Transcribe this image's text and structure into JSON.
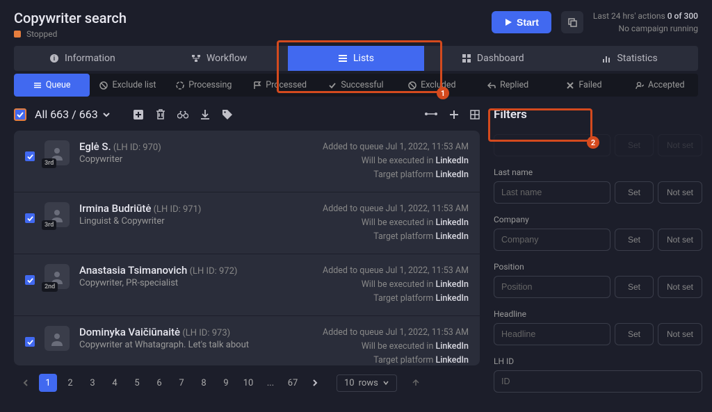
{
  "header": {
    "title": "Copywriter search",
    "status": "Stopped",
    "start_label": "Start",
    "stats_line1_prefix": "Last 24 hrs' actions ",
    "stats_line1_value": "0 of 300",
    "stats_line2": "No campaign running"
  },
  "main_tabs": {
    "information": "Information",
    "workflow": "Workflow",
    "lists": "Lists",
    "dashboard": "Dashboard",
    "statistics": "Statistics"
  },
  "sub_tabs": {
    "queue": "Queue",
    "exclude": "Exclude list",
    "processing": "Processing",
    "processed": "Processed",
    "successful": "Successful",
    "excluded": "Excluded",
    "replied": "Replied",
    "failed": "Failed",
    "accepted": "Accepted"
  },
  "list": {
    "count_label": "All 663 / 663",
    "items": [
      {
        "name": "Eglė S.",
        "id": "(LH ID: 970)",
        "sub": "Copywriter",
        "degree": "3rd",
        "added": "Added to queue Jul 1, 2022, 11:53 AM",
        "exec_prefix": "Will be executed in ",
        "exec_platform": "LinkedIn",
        "target_prefix": "Target platform ",
        "target_platform": "LinkedIn"
      },
      {
        "name": "Irmina Budriūtė",
        "id": "(LH ID: 971)",
        "sub": "Linguist & Copywriter",
        "degree": "3rd",
        "added": "Added to queue Jul 1, 2022, 11:53 AM",
        "exec_prefix": "Will be executed in ",
        "exec_platform": "LinkedIn",
        "target_prefix": "Target platform ",
        "target_platform": "LinkedIn"
      },
      {
        "name": "Anastasia Tsimanovich",
        "id": "(LH ID: 972)",
        "sub": "Copywriter, PR-specialist",
        "degree": "2nd",
        "added": "Added to queue Jul 1, 2022, 11:53 AM",
        "exec_prefix": "Will be executed in ",
        "exec_platform": "LinkedIn",
        "target_prefix": "Target platform ",
        "target_platform": "LinkedIn"
      },
      {
        "name": "Dominyka Vaičiūnaitė",
        "id": "(LH ID: 973)",
        "sub": "Copywriter at Whatagraph. Let's talk about",
        "degree": "",
        "added": "Added to queue Jul 1, 2022, 11:53 AM",
        "exec_prefix": "Will be executed in ",
        "exec_platform": "LinkedIn",
        "target_prefix": "Target platform ",
        "target_platform": "LinkedIn"
      }
    ]
  },
  "pagination": {
    "pages": [
      "1",
      "2",
      "3",
      "4",
      "5",
      "6",
      "7",
      "8",
      "9",
      "10",
      "...",
      "67"
    ],
    "rows_value": "10",
    "rows_label": "rows"
  },
  "filters": {
    "title": "Filters",
    "last_name_label": "Last name",
    "last_name_placeholder": "Last name",
    "company_label": "Company",
    "company_placeholder": "Company",
    "position_label": "Position",
    "position_placeholder": "Position",
    "headline_label": "Headline",
    "headline_placeholder": "Headline",
    "lhid_label": "LH ID",
    "lhid_placeholder": "ID",
    "set_label": "Set",
    "notset_label": "Not set"
  },
  "annotations": {
    "a1": "1",
    "a2": "2"
  }
}
